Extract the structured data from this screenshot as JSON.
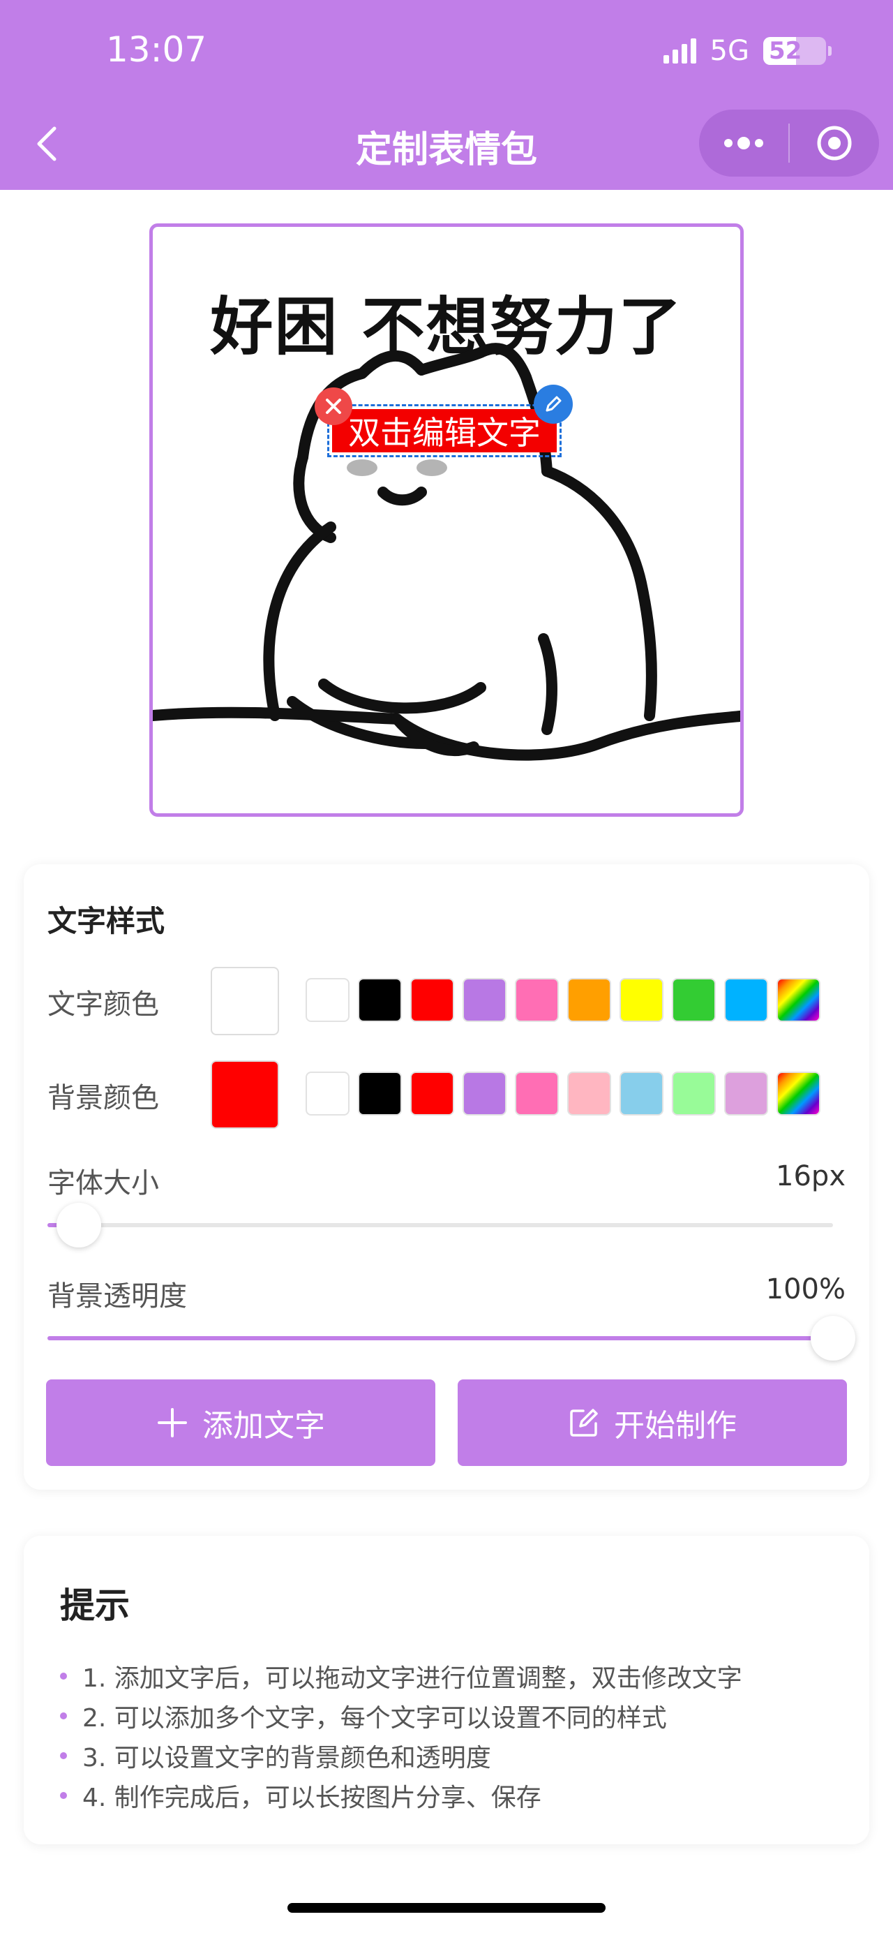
{
  "status_bar": {
    "time": "13:07",
    "network": "5G",
    "battery": "52"
  },
  "nav": {
    "title": "定制表情包"
  },
  "canvas": {
    "meme_text": "好困 不想努力了",
    "sticker_text": "双击编辑文字"
  },
  "style_panel": {
    "title": "文字样式",
    "text_color_label": "文字颜色",
    "bg_color_label": "背景颜色",
    "text_color_current": "#ffffff",
    "bg_color_current": "#ff0000",
    "text_palette": [
      "#ffffff",
      "#000000",
      "#ff0000",
      "#b878e4",
      "#ff6eb4",
      "#ff9f00",
      "#ffff00",
      "#33cc33",
      "#00b2ff",
      "rainbow"
    ],
    "bg_palette": [
      "#ffffff",
      "#000000",
      "#ff0000",
      "#b878e4",
      "#ff6eb4",
      "#ffb6c1",
      "#87ceeb",
      "#98fb98",
      "#dda0dd",
      "rainbow"
    ],
    "font_size_label": "字体大小",
    "font_size_value": "16px",
    "font_size_fraction": 0.04,
    "opacity_label": "背景透明度",
    "opacity_value": "100%",
    "opacity_fraction": 1.0,
    "add_text_label": "添加文字",
    "start_label": "开始制作"
  },
  "tips": {
    "title": "提示",
    "items": [
      "1. 添加文字后，可以拖动文字进行位置调整，双击修改文字",
      "2. 可以添加多个文字，每个文字可以设置不同的样式",
      "3. 可以设置文字的背景颜色和透明度",
      "4. 制作完成后，可以长按图片分享、保存"
    ]
  },
  "colors": {
    "accent": "#c17ee8",
    "sticker_bg": "#f30000",
    "delete": "#ef4848",
    "edit": "#2a7de1"
  },
  "icons": [
    "back-chevron-icon",
    "more-dots-icon",
    "target-circle-icon",
    "close-icon",
    "pencil-icon",
    "plus-icon",
    "edit-square-icon"
  ]
}
